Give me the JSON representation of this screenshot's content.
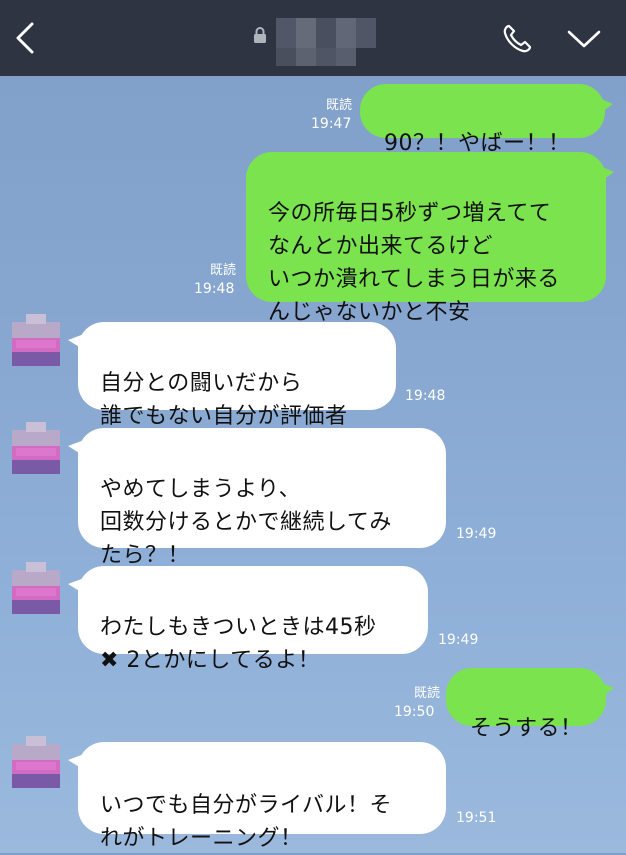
{
  "header": {
    "title": "",
    "back_icon": "chevron-left-icon",
    "lock_icon": "lock-icon",
    "call_icon": "phone-icon",
    "menu_icon": "chevron-down-icon"
  },
  "messages": [
    {
      "side": "me",
      "text": "90？！やばー！！",
      "read": "既読",
      "time": "19:47"
    },
    {
      "side": "me",
      "text": "今の所毎日5秒ずつ増えてて\nなんとか出来てるけど\nいつか潰れてしまう日が来る\nんじゃないかと不安",
      "read": "既読",
      "time": "19:48"
    },
    {
      "side": "them",
      "text": "自分との闘いだから\n誰でもない自分が評価者",
      "time": "19:48"
    },
    {
      "side": "them",
      "text": "やめてしまうより、\n回数分けるとかで継続してみ\nたら？！",
      "time": "19:49"
    },
    {
      "side": "them",
      "text": "わたしもきついときは45秒\n✖ 2とかにしてるよ！",
      "time": "19:49"
    },
    {
      "side": "me",
      "text": "そうする！",
      "read": "既読",
      "time": "19:50"
    },
    {
      "side": "them",
      "text": "いつでも自分がライバル！そ\nれがトレーニング！",
      "time": "19:51"
    }
  ],
  "colors": {
    "header_bg": "#2e3442",
    "my_bubble": "#7ae34e",
    "their_bubble": "#ffffff",
    "chat_bg": "#86a6cf"
  }
}
